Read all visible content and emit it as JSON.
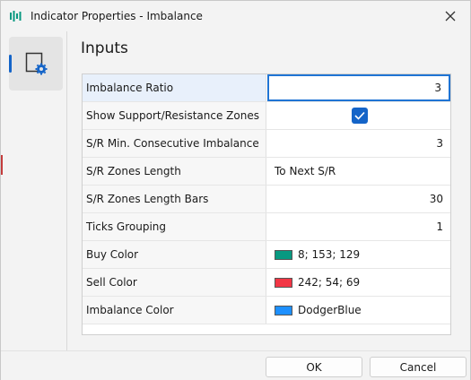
{
  "window": {
    "title": "Indicator Properties - Imbalance"
  },
  "sidebar": {
    "tabs": [
      {
        "icon": "settings-page-icon"
      }
    ]
  },
  "main": {
    "section_title": "Inputs",
    "rows": [
      {
        "label": "Imbalance Ratio",
        "value": "3"
      },
      {
        "label": "Show Support/Resistance Zones",
        "checked": true
      },
      {
        "label": "S/R Min. Consecutive Imbalance",
        "value": "3"
      },
      {
        "label": "S/R Zones Length",
        "value": "To Next S/R"
      },
      {
        "label": "S/R Zones Length Bars",
        "value": "30"
      },
      {
        "label": "Ticks Grouping",
        "value": "1"
      },
      {
        "label": "Buy Color",
        "value": "8; 153; 129",
        "color": "#089981"
      },
      {
        "label": "Sell Color",
        "value": "242; 54; 69",
        "color": "#F23645"
      },
      {
        "label": "Imbalance Color",
        "value": "DodgerBlue",
        "color": "#1E90FF"
      }
    ]
  },
  "footer": {
    "ok_label": "OK",
    "cancel_label": "Cancel"
  },
  "colors": {
    "accent": "#1464c8"
  }
}
